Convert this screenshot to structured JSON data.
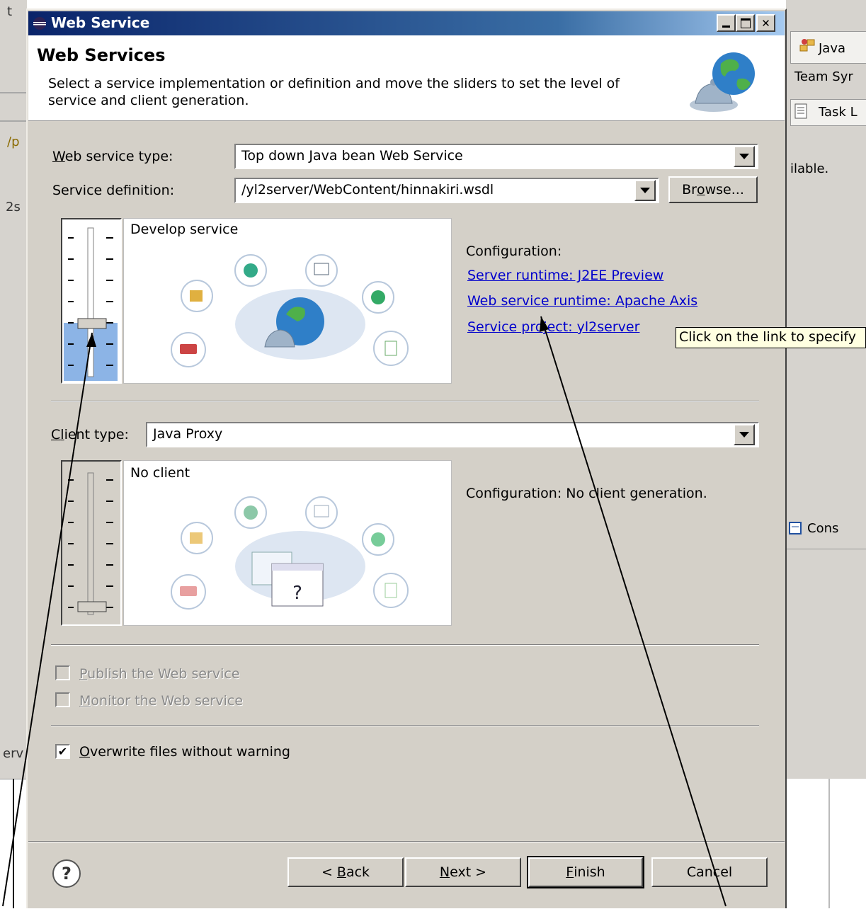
{
  "background": {
    "left_texts": [
      "t",
      "/p",
      "2s",
      "erv"
    ],
    "right_tabs": {
      "java": "Java",
      "team": "Team Syr",
      "task": "Task L",
      "console": "Cons"
    },
    "right_status": "ilable."
  },
  "dialog": {
    "title": "Web Service",
    "banner": {
      "title": "Web Services",
      "description": "Select a service implementation or definition and move the sliders to set the level of service and client generation."
    },
    "service_type": {
      "label_prefix": "W",
      "label_rest": "eb service type:",
      "value": "Top down Java bean Web Service"
    },
    "service_definition": {
      "label": "Service definition:",
      "value": "/yl2server/WebContent/hinnakiri.wsdl",
      "browse_pre": "Br",
      "browse_u": "o",
      "browse_post": "wse..."
    },
    "service_slider": {
      "level_label": "Develop service",
      "level_fraction": 0.17
    },
    "service_config": {
      "heading": "Configuration:",
      "server_runtime": "Server runtime: J2EE Preview",
      "ws_runtime": "Web service runtime: Apache Axis",
      "service_project": "Service project: yl2server"
    },
    "tooltip": "Click on the link to specify",
    "client_type": {
      "label_prefix": "C",
      "label_u": "l",
      "label_rest": "ient type:",
      "value": "Java Proxy"
    },
    "client_slider": {
      "level_label": "No client",
      "level_fraction": 0.0
    },
    "client_config": "Configuration: No client generation.",
    "options": {
      "publish": {
        "u": "P",
        "rest": "ublish the Web service",
        "checked": false,
        "enabled": false
      },
      "monitor": {
        "u": "M",
        "rest": "onitor the Web service",
        "checked": false,
        "enabled": false
      },
      "overwrite": {
        "u": "O",
        "rest": "verwrite files without warning",
        "checked": true,
        "enabled": true
      }
    },
    "buttons": {
      "back_pre": "< ",
      "back_u": "B",
      "back_post": "ack",
      "next_u": "N",
      "next_post": "ext >",
      "finish_u": "F",
      "finish_post": "inish",
      "cancel": "Cancel"
    },
    "help_glyph": "?"
  }
}
